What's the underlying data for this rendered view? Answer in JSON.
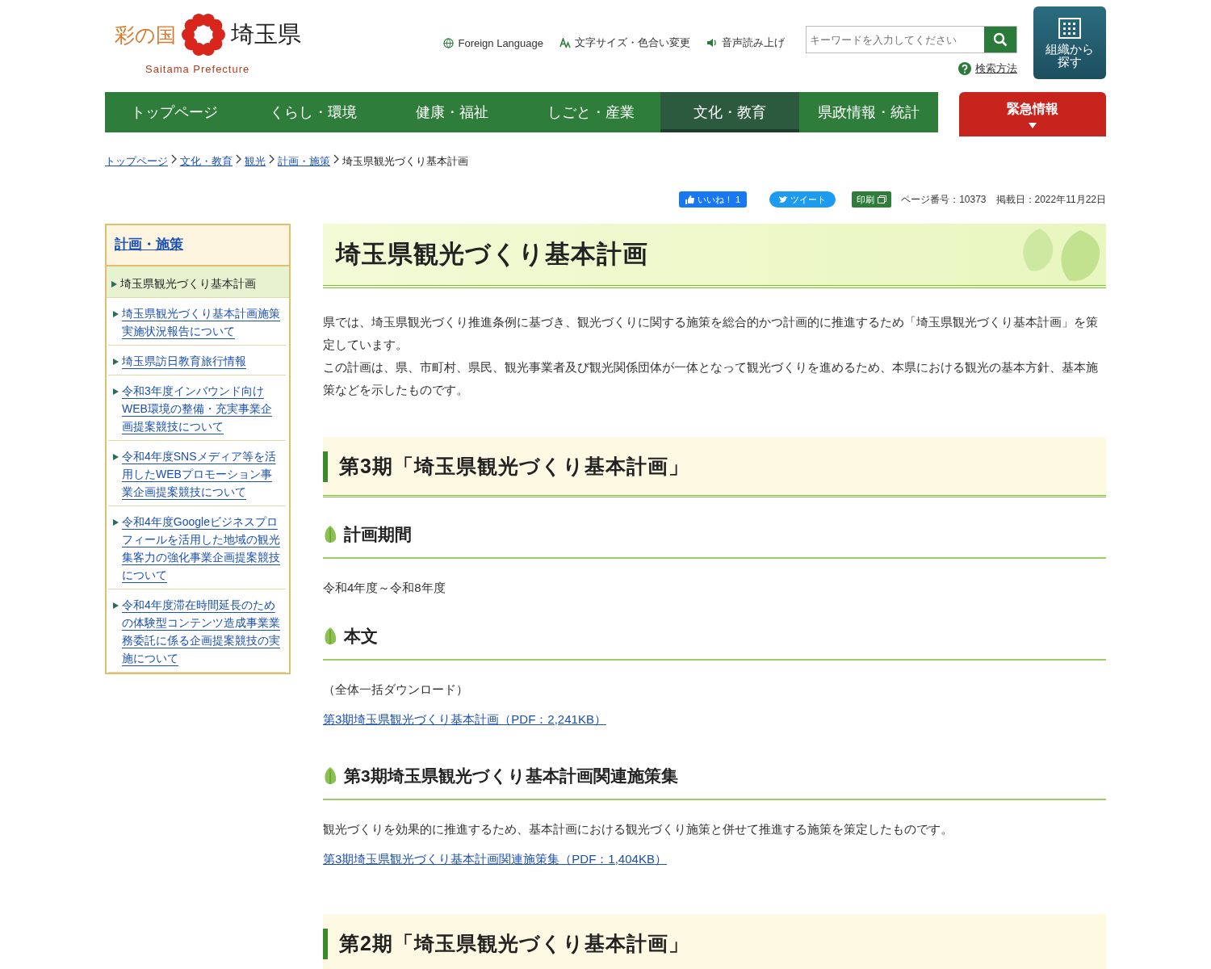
{
  "logo": {
    "tagline": "彩の国",
    "name": "埼玉県",
    "roman": "Saitama Prefecture"
  },
  "utility_links": [
    {
      "kind": "globe",
      "label": "Foreign Language"
    },
    {
      "kind": "text-size",
      "label": "文字サイズ・色合い変更"
    },
    {
      "kind": "speaker",
      "label": "音声読み上げ"
    }
  ],
  "search": {
    "placeholder": "キーワードを入力してください",
    "help": "検索方法"
  },
  "org_button": {
    "label": "組織から探す"
  },
  "nav": [
    {
      "label": "トップページ",
      "selected": false
    },
    {
      "label": "くらし・環境",
      "selected": false
    },
    {
      "label": "健康・福祉",
      "selected": false
    },
    {
      "label": "しごと・産業",
      "selected": false
    },
    {
      "label": "文化・教育",
      "selected": true
    },
    {
      "label": "県政情報・統計",
      "selected": false
    }
  ],
  "emergency": {
    "label": "緊急情報"
  },
  "breadcrumb": {
    "links": [
      "トップページ",
      "文化・教育",
      "観光",
      "計画・施策"
    ],
    "current": "埼玉県観光づくり基本計画"
  },
  "share": {
    "like": "いいね！ 1",
    "tweet": "ツイート",
    "print": "印刷",
    "page_number": "ページ番号：10373",
    "posted": "掲載日：2022年11月22日"
  },
  "sidebar": {
    "title": "計画・施策",
    "items": [
      {
        "label": "埼玉県観光づくり基本計画",
        "selected": true
      },
      {
        "label": "埼玉県観光づくり基本計画施策実施状況報告について",
        "selected": false
      },
      {
        "label": "埼玉県訪日教育旅行情報",
        "selected": false
      },
      {
        "label": "令和3年度インバウンド向けWEB環境の整備・充実事業企画提案競技について",
        "selected": false
      },
      {
        "label": "令和4年度SNSメディア等を活用したWEBプロモーション事業企画提案競技について",
        "selected": false
      },
      {
        "label": "令和4年度Googleビジネスプロフィールを活用した地域の観光集客力の強化事業企画提案競技について",
        "selected": false
      },
      {
        "label": "令和4年度滞在時間延長のための体験型コンテンツ造成事業業務委託に係る企画提案競技の実施について",
        "selected": false
      }
    ]
  },
  "title": "埼玉県観光づくり基本計画",
  "content": [
    {
      "kind": "p",
      "text": "県では、埼玉県観光づくり推進条例に基づき、観光づくりに関する施策を総合的かつ計画的に推進するため「埼玉県観光づくり基本計画」を策定しています。"
    },
    {
      "kind": "p",
      "text": "この計画は、県、市町村、県民、観光事業者及び観光関係団体が一体となって観光づくりを進めるため、本県における観光の基本方針、基本施策などを示したものです。"
    },
    {
      "kind": "h2",
      "text": "第3期「埼玉県観光づくり基本計画」"
    },
    {
      "kind": "h3",
      "text": "計画期間"
    },
    {
      "kind": "p",
      "text": "令和4年度～令和8年度"
    },
    {
      "kind": "h3",
      "text": "本文"
    },
    {
      "kind": "p",
      "text": "（全体一括ダウンロード）"
    },
    {
      "kind": "link",
      "text": "第3期埼玉県観光づくり基本計画（PDF：2,241KB）"
    },
    {
      "kind": "h3",
      "text": "第3期埼玉県観光づくり基本計画関連施策集"
    },
    {
      "kind": "p",
      "text": "観光づくりを効果的に推進するため、基本計画における観光づくり施策と併せて推進する施策を策定したものです。"
    },
    {
      "kind": "link",
      "text": "第3期埼玉県観光づくり基本計画関連施策集（PDF：1,404KB）"
    },
    {
      "kind": "h2",
      "text": "第2期「埼玉県観光づくり基本計画」"
    }
  ]
}
